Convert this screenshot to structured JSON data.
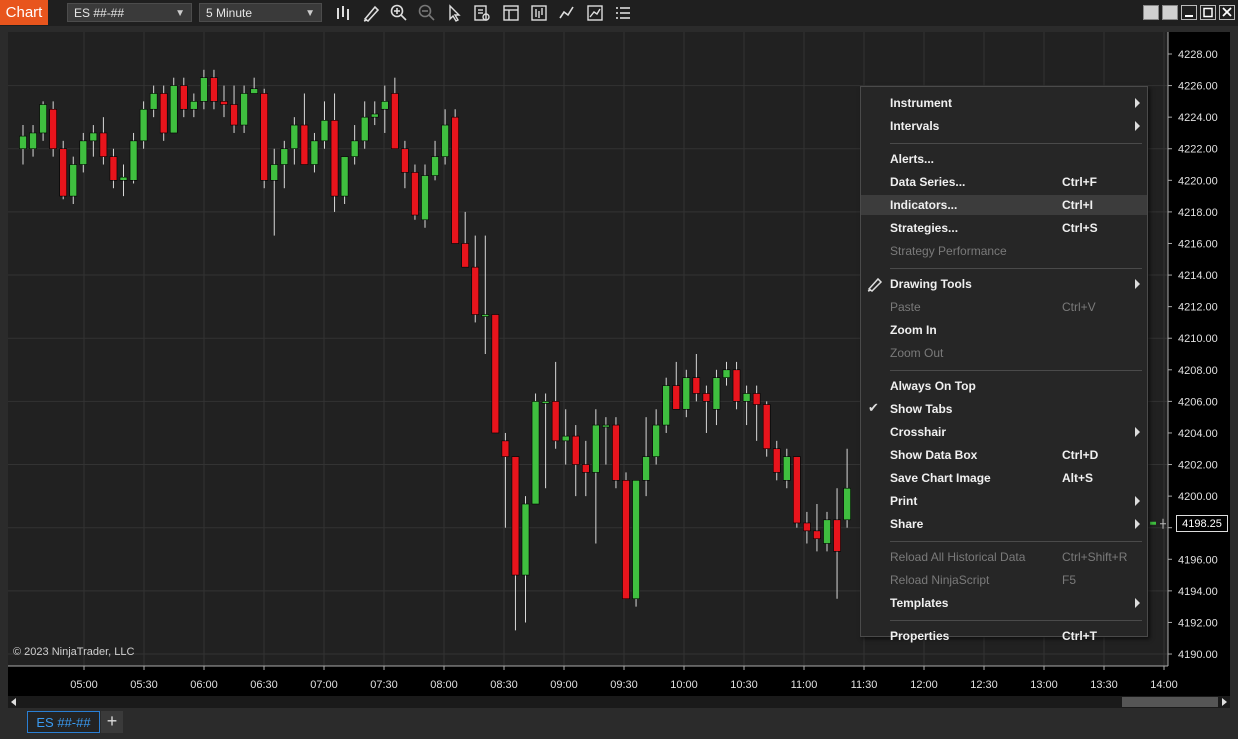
{
  "app_tab": "Chart",
  "instrument": "ES ##-##",
  "interval": "5 Minute",
  "copyright": "© 2023 NinjaTrader, LLC",
  "last_price": "4198.25",
  "chart_tab": "ES ##-##",
  "add_tab": "+",
  "colors": {
    "up": "#3fbf3f",
    "down": "#e8141c",
    "accent": "#e8551d",
    "tab": "#3a9bf2"
  },
  "chart_data": {
    "type": "candlestick",
    "ylim": [
      4189.5,
      4229.5
    ],
    "y_ticks": [
      "4228.00",
      "4226.00",
      "4224.00",
      "4222.00",
      "4220.00",
      "4218.00",
      "4216.00",
      "4214.00",
      "4212.00",
      "4210.00",
      "4208.00",
      "4206.00",
      "4204.00",
      "4202.00",
      "4200.00",
      "4198.00",
      "4196.00",
      "4194.00",
      "4192.00",
      "4190.00"
    ],
    "x_ticks": [
      "05:00",
      "05:30",
      "06:00",
      "06:30",
      "07:00",
      "07:30",
      "08:00",
      "08:30",
      "09:00",
      "09:30",
      "10:00",
      "10:30",
      "11:00",
      "11:30",
      "12:00",
      "12:30",
      "13:00",
      "13:30",
      "14:00"
    ],
    "ohlc": [
      [
        4222.0,
        4223.5,
        4221.0,
        4222.8
      ],
      [
        4222.0,
        4223.5,
        4221.5,
        4223.0
      ],
      [
        4223.0,
        4225.0,
        4222.5,
        4224.8
      ],
      [
        4224.5,
        4225.0,
        4221.5,
        4222.0
      ],
      [
        4222.0,
        4222.5,
        4218.8,
        4219.0
      ],
      [
        4219.0,
        4221.5,
        4218.5,
        4221.0
      ],
      [
        4221.0,
        4223.0,
        4220.5,
        4222.5
      ],
      [
        4222.5,
        4223.5,
        4221.5,
        4223.0
      ],
      [
        4223.0,
        4224.0,
        4221.0,
        4221.5
      ],
      [
        4221.5,
        4222.0,
        4219.5,
        4220.0
      ],
      [
        4220.0,
        4221.0,
        4219.0,
        4220.2
      ],
      [
        4220.0,
        4223.0,
        4219.8,
        4222.5
      ],
      [
        4222.5,
        4225.0,
        4222.0,
        4224.5
      ],
      [
        4224.5,
        4226.0,
        4224.0,
        4225.5
      ],
      [
        4225.5,
        4226.0,
        4222.5,
        4223.0
      ],
      [
        4223.0,
        4226.5,
        4223.0,
        4226.0
      ],
      [
        4226.0,
        4226.5,
        4224.0,
        4224.5
      ],
      [
        4224.5,
        4225.5,
        4224.0,
        4225.0
      ],
      [
        4225.0,
        4227.0,
        4224.5,
        4226.5
      ],
      [
        4226.5,
        4227.0,
        4224.5,
        4225.0
      ],
      [
        4225.0,
        4226.0,
        4224.0,
        4224.8
      ],
      [
        4224.8,
        4226.0,
        4223.0,
        4223.5
      ],
      [
        4223.5,
        4226.0,
        4223.0,
        4225.5
      ],
      [
        4225.5,
        4226.5,
        4225.5,
        4225.8
      ],
      [
        4225.5,
        4225.8,
        4219.5,
        4220.0
      ],
      [
        4220.0,
        4222.0,
        4216.5,
        4221.0
      ],
      [
        4221.0,
        4222.5,
        4219.5,
        4222.0
      ],
      [
        4222.0,
        4224.0,
        4221.0,
        4223.5
      ],
      [
        4223.5,
        4225.5,
        4221.0,
        4221.0
      ],
      [
        4221.0,
        4223.0,
        4220.5,
        4222.5
      ],
      [
        4222.5,
        4225.0,
        4222.0,
        4223.8
      ],
      [
        4223.8,
        4225.5,
        4218.0,
        4219.0
      ],
      [
        4219.0,
        4221.5,
        4218.5,
        4221.5
      ],
      [
        4221.5,
        4223.5,
        4221.0,
        4222.5
      ],
      [
        4222.5,
        4225.0,
        4222.0,
        4224.0
      ],
      [
        4224.0,
        4225.0,
        4223.5,
        4224.2
      ],
      [
        4224.5,
        4226.0,
        4223.0,
        4225.0
      ],
      [
        4225.5,
        4226.5,
        4222.0,
        4222.0
      ],
      [
        4222.0,
        4222.5,
        4219.5,
        4220.5
      ],
      [
        4220.5,
        4221.0,
        4217.5,
        4217.8
      ],
      [
        4217.5,
        4221.0,
        4217.0,
        4220.3
      ],
      [
        4220.3,
        4222.5,
        4220.0,
        4221.5
      ],
      [
        4221.5,
        4224.5,
        4221.0,
        4223.5
      ],
      [
        4224.0,
        4224.5,
        4216.0,
        4216.0
      ],
      [
        4216.0,
        4218.0,
        4214.5,
        4214.5
      ],
      [
        4214.5,
        4216.5,
        4211.0,
        4211.5
      ],
      [
        4211.5,
        4216.5,
        4209.0,
        4211.5
      ],
      [
        4211.5,
        4211.5,
        4204.0,
        4204.0
      ],
      [
        4203.5,
        4204.0,
        4198.0,
        4202.5
      ],
      [
        4202.5,
        4202.5,
        4191.5,
        4195.0
      ],
      [
        4195.0,
        4200.0,
        4192.0,
        4199.5
      ],
      [
        4199.5,
        4206.5,
        4199.5,
        4206.0
      ],
      [
        4206.0,
        4206.5,
        4200.5,
        4206.0
      ],
      [
        4206.0,
        4208.5,
        4203.0,
        4203.5
      ],
      [
        4203.5,
        4205.5,
        4202.0,
        4203.8
      ],
      [
        4203.8,
        4204.5,
        4200.0,
        4202.0
      ],
      [
        4202.0,
        4203.5,
        4200.0,
        4201.5
      ],
      [
        4201.5,
        4205.5,
        4197.0,
        4204.5
      ],
      [
        4204.5,
        4205.0,
        4202.0,
        4204.5
      ],
      [
        4204.5,
        4205.0,
        4200.5,
        4201.0
      ],
      [
        4201.0,
        4201.5,
        4193.5,
        4193.5
      ],
      [
        4193.5,
        4201.0,
        4193.0,
        4201.0
      ],
      [
        4201.0,
        4205.0,
        4200.0,
        4202.5
      ],
      [
        4202.5,
        4205.5,
        4202.0,
        4204.5
      ],
      [
        4204.5,
        4207.5,
        4204.0,
        4207.0
      ],
      [
        4207.0,
        4208.5,
        4205.5,
        4205.5
      ],
      [
        4205.5,
        4208.0,
        4205.0,
        4207.5
      ],
      [
        4207.5,
        4209.0,
        4206.0,
        4206.5
      ],
      [
        4206.5,
        4207.0,
        4204.0,
        4206.0
      ],
      [
        4205.5,
        4208.0,
        4204.5,
        4207.5
      ],
      [
        4207.5,
        4208.5,
        4207.0,
        4208.0
      ],
      [
        4208.0,
        4208.5,
        4205.5,
        4206.0
      ],
      [
        4206.0,
        4207.0,
        4204.5,
        4206.5
      ],
      [
        4206.5,
        4207.0,
        4203.5,
        4205.8
      ],
      [
        4205.8,
        4206.0,
        4202.5,
        4203.0
      ],
      [
        4203.0,
        4203.5,
        4201.0,
        4201.5
      ],
      [
        4201.0,
        4203.0,
        4200.5,
        4202.5
      ],
      [
        4202.5,
        4202.5,
        4198.0,
        4198.3
      ],
      [
        4198.3,
        4199.0,
        4197.0,
        4197.8
      ],
      [
        4197.8,
        4199.5,
        4196.5,
        4197.3
      ],
      [
        4197.0,
        4199.0,
        4196.5,
        4198.5
      ],
      [
        4198.5,
        4200.5,
        4193.5,
        4196.5
      ],
      [
        4198.5,
        4203.0,
        4198.0,
        4200.5
      ]
    ],
    "current_price": 4198.25
  },
  "menu": {
    "items": [
      {
        "label": "Instrument",
        "shortcut": "",
        "submenu": true,
        "disabled": false
      },
      {
        "label": "Intervals",
        "shortcut": "",
        "submenu": true,
        "disabled": false
      },
      {
        "label": "Alerts...",
        "shortcut": "",
        "submenu": false,
        "disabled": false
      },
      {
        "label": "Data Series...",
        "shortcut": "Ctrl+F",
        "submenu": false,
        "disabled": false
      },
      {
        "label": "Indicators...",
        "shortcut": "Ctrl+I",
        "submenu": false,
        "disabled": false,
        "highlighted": true
      },
      {
        "label": "Strategies...",
        "shortcut": "Ctrl+S",
        "submenu": false,
        "disabled": false
      },
      {
        "label": "Strategy Performance",
        "shortcut": "",
        "submenu": false,
        "disabled": true
      },
      {
        "label": "Drawing Tools",
        "shortcut": "",
        "submenu": true,
        "disabled": false,
        "icon": "pencil-icon"
      },
      {
        "label": "Paste",
        "shortcut": "Ctrl+V",
        "submenu": false,
        "disabled": true
      },
      {
        "label": "Zoom In",
        "shortcut": "",
        "submenu": false,
        "disabled": false
      },
      {
        "label": "Zoom Out",
        "shortcut": "",
        "submenu": false,
        "disabled": true
      },
      {
        "label": "Always On Top",
        "shortcut": "",
        "submenu": false,
        "disabled": false
      },
      {
        "label": "Show Tabs",
        "shortcut": "",
        "submenu": false,
        "disabled": false,
        "checked": true
      },
      {
        "label": "Crosshair",
        "shortcut": "",
        "submenu": true,
        "disabled": false
      },
      {
        "label": "Show Data Box",
        "shortcut": "Ctrl+D",
        "submenu": false,
        "disabled": false
      },
      {
        "label": "Save Chart Image",
        "shortcut": "Alt+S",
        "submenu": false,
        "disabled": false
      },
      {
        "label": "Print",
        "shortcut": "",
        "submenu": true,
        "disabled": false
      },
      {
        "label": "Share",
        "shortcut": "",
        "submenu": true,
        "disabled": false
      },
      {
        "label": "Reload All Historical Data",
        "shortcut": "Ctrl+Shift+R",
        "submenu": false,
        "disabled": true
      },
      {
        "label": "Reload NinjaScript",
        "shortcut": "F5",
        "submenu": false,
        "disabled": true
      },
      {
        "label": "Templates",
        "shortcut": "",
        "submenu": true,
        "disabled": false
      },
      {
        "label": "Properties",
        "shortcut": "Ctrl+T",
        "submenu": false,
        "disabled": false
      }
    ]
  }
}
